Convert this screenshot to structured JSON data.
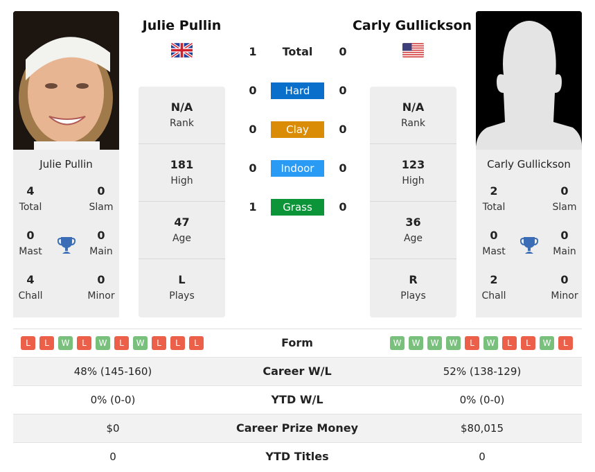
{
  "colors": {
    "hard": "#0a6ecb",
    "clay": "#db8c06",
    "indoor": "#2a9bf4",
    "grass": "#0c9438",
    "win": "#79c07d",
    "loss": "#ec5f48",
    "trophy": "#3a6db5"
  },
  "player1": {
    "name": "Julie Pullin",
    "flag": "uk-flag",
    "rank": "N/A",
    "rank_label": "Rank",
    "high": "181",
    "high_label": "High",
    "age": "47",
    "age_label": "Age",
    "plays": "L",
    "plays_label": "Plays",
    "titles": {
      "total": "4",
      "total_label": "Total",
      "slam": "0",
      "slam_label": "Slam",
      "mast": "0",
      "mast_label": "Mast",
      "main": "0",
      "main_label": "Main",
      "chall": "4",
      "chall_label": "Chall",
      "minor": "0",
      "minor_label": "Minor"
    },
    "form": [
      "L",
      "L",
      "W",
      "L",
      "W",
      "L",
      "W",
      "L",
      "L",
      "L"
    ],
    "career_wl": "48% (145-160)",
    "ytd_wl": "0% (0-0)",
    "prize_money": "$0",
    "ytd_titles": "0"
  },
  "player2": {
    "name": "Carly Gullickson",
    "flag": "us-flag",
    "rank": "N/A",
    "rank_label": "Rank",
    "high": "123",
    "high_label": "High",
    "age": "36",
    "age_label": "Age",
    "plays": "R",
    "plays_label": "Plays",
    "titles": {
      "total": "2",
      "total_label": "Total",
      "slam": "0",
      "slam_label": "Slam",
      "mast": "0",
      "mast_label": "Mast",
      "main": "0",
      "main_label": "Main",
      "chall": "2",
      "chall_label": "Chall",
      "minor": "0",
      "minor_label": "Minor"
    },
    "form": [
      "W",
      "W",
      "W",
      "W",
      "L",
      "W",
      "L",
      "L",
      "W",
      "L"
    ],
    "career_wl": "52% (138-129)",
    "ytd_wl": "0% (0-0)",
    "prize_money": "$80,015",
    "ytd_titles": "0"
  },
  "h2h": [
    {
      "label": "Total",
      "p1": "1",
      "p2": "0",
      "type": "total"
    },
    {
      "label": "Hard",
      "p1": "0",
      "p2": "0",
      "type": "hard"
    },
    {
      "label": "Clay",
      "p1": "0",
      "p2": "0",
      "type": "clay"
    },
    {
      "label": "Indoor",
      "p1": "0",
      "p2": "0",
      "type": "indoor"
    },
    {
      "label": "Grass",
      "p1": "1",
      "p2": "0",
      "type": "grass"
    }
  ],
  "table_labels": {
    "form": "Form",
    "career_wl": "Career W/L",
    "ytd_wl": "YTD W/L",
    "prize_money": "Career Prize Money",
    "ytd_titles": "YTD Titles"
  }
}
